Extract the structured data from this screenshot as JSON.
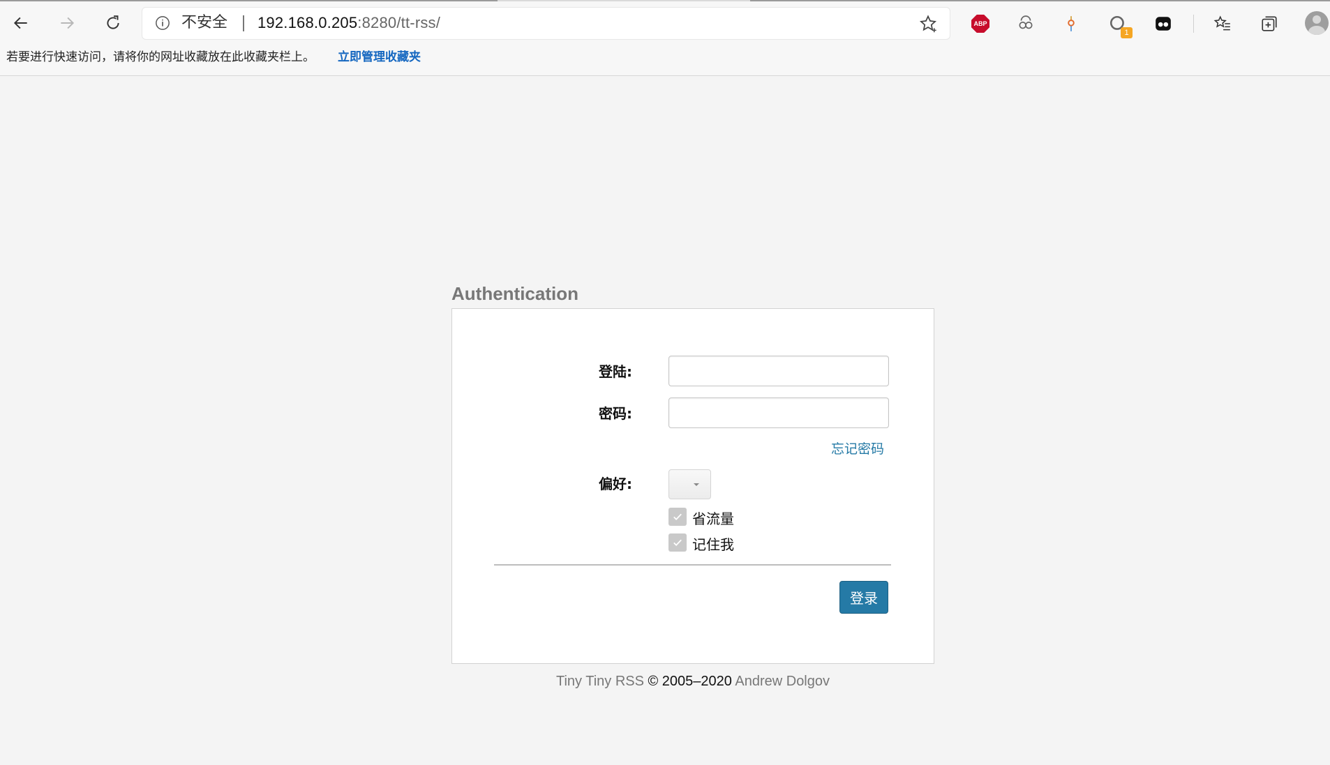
{
  "browser": {
    "address": {
      "security_label": "不安全",
      "url_host": "192.168.0.205",
      "url_rest": ":8280/tt-rss/"
    },
    "extensions": [
      {
        "name": "adblock-plus-icon",
        "text": "ABP"
      },
      {
        "name": "extension-link-icon"
      },
      {
        "name": "extension-pin-icon"
      },
      {
        "name": "extension-search-icon",
        "badge": "1"
      },
      {
        "name": "extension-face-icon"
      }
    ]
  },
  "favorites_bar": {
    "message": "若要进行快速访问，请将你的网址收藏放在此收藏夹栏上。",
    "manage_link": "立即管理收藏夹"
  },
  "auth": {
    "title": "Authentication",
    "login_label": "登陆:",
    "login_value": "",
    "password_label": "密码:",
    "password_value": "",
    "forgot_link": "忘记密码",
    "prefs_label": "偏好:",
    "prefs_value": "",
    "safe_mode_label": "省流量",
    "safe_mode_checked": true,
    "remember_label": "记住我",
    "remember_checked": true,
    "submit_label": "登录"
  },
  "footer": {
    "app_name": "Tiny Tiny RSS",
    "copyright": "© 2005–2020",
    "author": "Andrew Dolgov"
  },
  "colors": {
    "accent": "#257aa6",
    "link": "#1567c0",
    "abp": "#c70d2c",
    "badge": "#f5a623"
  }
}
